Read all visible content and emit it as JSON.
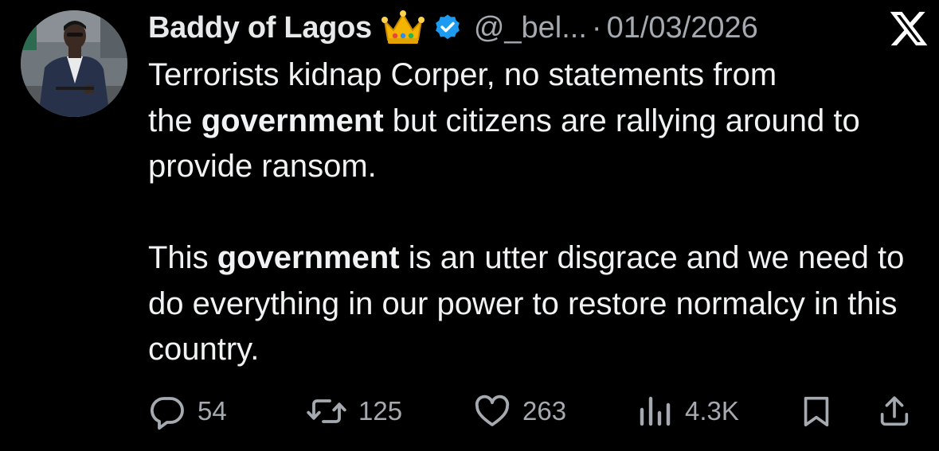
{
  "tweet": {
    "author": {
      "name": "Baddy of Lagos",
      "emoji": "👑",
      "handle": "@_bel...",
      "verified": true
    },
    "separator": "·",
    "date": "01/03/2026",
    "text": {
      "line1": "Terrorists kidnap Corper, no statements from",
      "p1_b_pre": "the ",
      "p1_bold": "government",
      "p1_b_post": " but citizens are rallying around to provide ransom.",
      "p2_pre": "This ",
      "p2_bold": "government",
      "p2_post": " is an utter disgrace and we need to do everything in our power to restore normalcy in this country."
    },
    "actions": {
      "replies": "54",
      "reposts": "125",
      "likes": "263",
      "views": "4.3K"
    }
  },
  "icons": {
    "platform": "x-logo",
    "reply": "reply-icon",
    "repost": "repost-icon",
    "like": "heart-icon",
    "views": "views-icon",
    "bookmark": "bookmark-icon",
    "share": "share-icon"
  },
  "colors": {
    "background": "#000000",
    "text": "#e7e9ea",
    "muted": "#a5aab0",
    "verified": "#1d9bf0",
    "crown": "#f4b400"
  }
}
